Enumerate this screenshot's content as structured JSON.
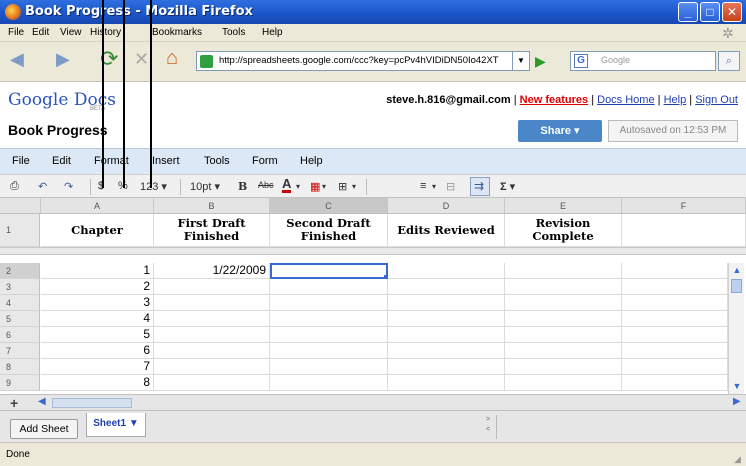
{
  "window": {
    "title": "Book Progress - Mozilla Firefox"
  },
  "browser_menu": [
    "File",
    "Edit",
    "View",
    "History",
    "Bookmarks",
    "Tools",
    "Help"
  ],
  "address_bar": {
    "url": "http://spreadsheets.google.com/ccc?key=pcPv4hVIDiDN50Io42XT"
  },
  "search_bar": {
    "placeholder": "Google",
    "engine_icon": "G"
  },
  "docs": {
    "logo_main": "Google Docs",
    "logo_sub": "BETA",
    "email": "steve.h.816@gmail.com",
    "separator": " | ",
    "links": [
      "New features",
      "Docs Home",
      "Help",
      "Sign Out"
    ],
    "doc_title": "Book Progress",
    "share_label": "Share ▾",
    "autosave": "Autosaved on 12:53 PM"
  },
  "app_menu": [
    "File",
    "Edit",
    "Format",
    "Insert",
    "Tools",
    "Form",
    "Help"
  ],
  "toolbar": {
    "currency": "$",
    "percent": "%",
    "number_format": "123 ▾",
    "font_size": "10pt ▾",
    "bold": "B",
    "strike": "Abc",
    "text_color": "A",
    "sum": "Σ ▾"
  },
  "grid": {
    "columns": [
      "A",
      "B",
      "C",
      "D",
      "E",
      "F"
    ],
    "header_row_number": "1",
    "headers": [
      "Chapter",
      "First Draft Finished",
      "Second Draft Finished",
      "Edits Reviewed",
      "Revision Complete",
      ""
    ],
    "rows": [
      {
        "num": "2",
        "a": "1",
        "b": "1/22/2009"
      },
      {
        "num": "3",
        "a": "2",
        "b": ""
      },
      {
        "num": "4",
        "a": "3",
        "b": ""
      },
      {
        "num": "5",
        "a": "4",
        "b": ""
      },
      {
        "num": "6",
        "a": "5",
        "b": ""
      },
      {
        "num": "7",
        "a": "6",
        "b": ""
      },
      {
        "num": "8",
        "a": "7",
        "b": ""
      },
      {
        "num": "9",
        "a": "8",
        "b": ""
      }
    ]
  },
  "sheets": {
    "add_label": "Add Sheet",
    "tabs": [
      "Sheet1 ▼"
    ]
  },
  "status": {
    "text": "Done"
  },
  "icons": {
    "back": "◀",
    "forward": "▶",
    "reload": "⟳",
    "stop": "✕",
    "home": "⌂",
    "go": "▶",
    "search": "⌕",
    "dropdown": "▼",
    "grip": "◢"
  }
}
